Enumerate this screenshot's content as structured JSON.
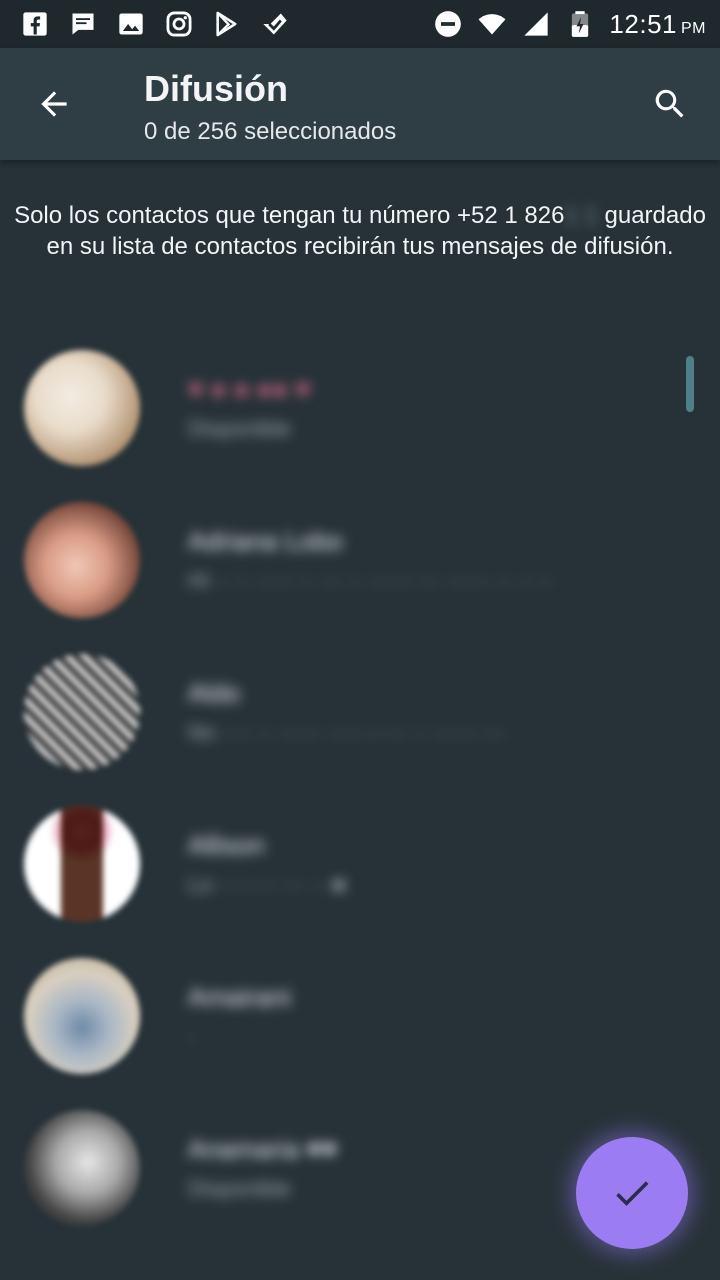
{
  "status_bar": {
    "time": "12:51",
    "ampm": "PM",
    "left_icons": [
      "facebook-icon",
      "message-icon",
      "gallery-icon",
      "instagram-icon",
      "play-store-icon",
      "feedly-icon"
    ],
    "right_icons": [
      "do-not-disturb-icon",
      "wifi-icon",
      "signal-icon",
      "battery-icon"
    ]
  },
  "app_bar": {
    "title": "Difusión",
    "subtitle": "0 de 256 seleccionados",
    "back_icon": "arrow-back-icon",
    "search_icon": "search-icon"
  },
  "notice": {
    "text_before": "Solo los contactos que tengan tu número +52 1 826",
    "masked_number": " 1 1",
    "text_after": " guardado en su lista de contactos recibirán tus mensajes de difusión."
  },
  "contacts": [
    {
      "name": "♥ ● ● ●● ♥",
      "status": "Disponible",
      "avatar_colors": [
        "#e9dccb",
        "#b89a7a"
      ]
    },
    {
      "name": "Adriana Lobo",
      "status": "Hi ·· ·· ····· ·· ··· ·· ······ ··· ······ ·· ·· ··",
      "avatar_colors": [
        "#7a4a3d",
        "#f1c8b6"
      ]
    },
    {
      "name": "Aldo",
      "status": "Nn ···· ·· ······ ····· - ··· ·· ······ ···",
      "avatar_colors": [
        "#3b3b3b",
        "#cfcfcf"
      ]
    },
    {
      "name": "Allison",
      "status": "Lo ········ ··· ·· ■",
      "avatar_colors": [
        "#ffffff",
        "#5a3526"
      ]
    },
    {
      "name": "Amairani",
      "status": "·",
      "avatar_colors": [
        "#d8cfc0",
        "#6f8aa8"
      ]
    },
    {
      "name": "Anamaria ♥♥",
      "status": "Disponible",
      "avatar_colors": [
        "#151515",
        "#c9c9c9"
      ]
    }
  ],
  "fab": {
    "icon": "check-icon",
    "color": "#9c7cf2"
  },
  "colors": {
    "background": "#263238",
    "app_bar": "#2f3e44",
    "status_bar": "#1e282d",
    "accent": "#9c7cf2"
  }
}
